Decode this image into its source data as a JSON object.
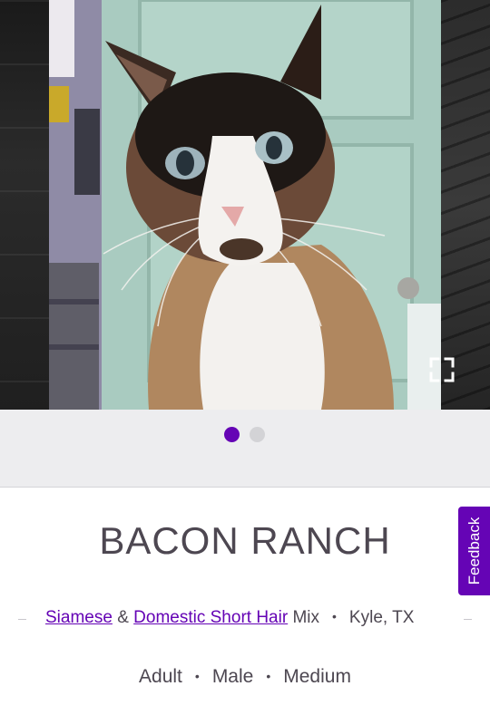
{
  "pet": {
    "name": "BACON RANCH",
    "breed_primary": "Siamese",
    "breed_connector": "&",
    "breed_secondary": "Domestic Short Hair",
    "breed_suffix": "Mix",
    "location": "Kyle, TX",
    "age": "Adult",
    "sex": "Male",
    "size": "Medium",
    "separator": "•"
  },
  "carousel": {
    "photo_count": 2,
    "active_index": 1,
    "fullscreen_icon": "fullscreen-icon"
  },
  "feedback": {
    "label": "Feedback"
  },
  "colors": {
    "brand": "#6504b5",
    "text": "#4d4751",
    "strip_bg": "#ededef",
    "dot_inactive": "#d3d3d6"
  }
}
